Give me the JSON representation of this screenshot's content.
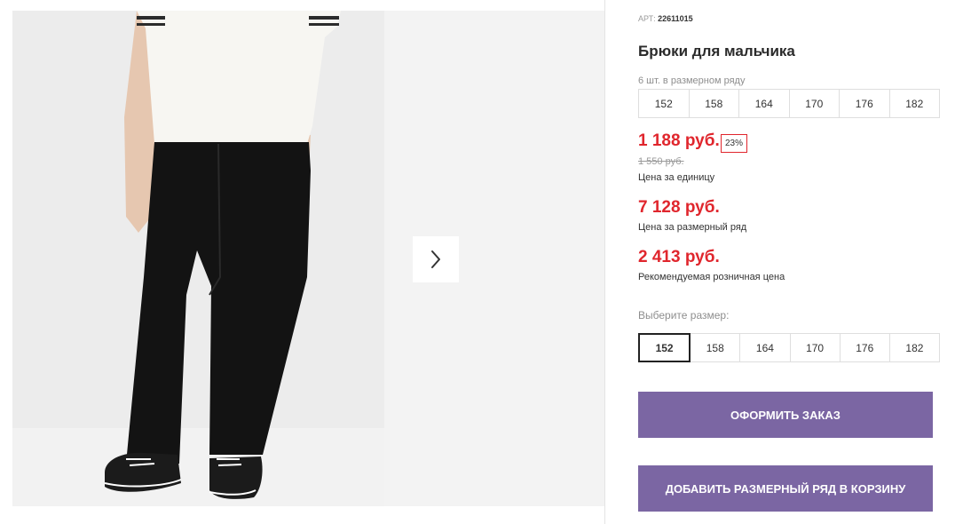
{
  "gallery": {
    "next_icon": "chevron-right-icon",
    "photo_alt": "Брюки для мальчика"
  },
  "product": {
    "article_label": "АРТ:",
    "article_value": "22611015",
    "title": "Брюки для мальчика",
    "pack_note": "6 шт. в размерном ряду",
    "pack_sizes": [
      "152",
      "158",
      "164",
      "170",
      "176",
      "182"
    ]
  },
  "pricing": {
    "unit_price": "1 188 руб.",
    "discount_badge": "23%",
    "old_price": "1 550 руб.",
    "unit_price_label": "Цена за единицу",
    "pack_price": "7 128 руб.",
    "pack_price_label": "Цена за размерный ряд",
    "retail_price": "2 413 руб.",
    "retail_price_label": "Рекомендуемая розничная цена"
  },
  "size_picker": {
    "label": "Выберите размер:",
    "sizes": [
      "152",
      "158",
      "164",
      "170",
      "176",
      "182"
    ],
    "selected": "152"
  },
  "actions": {
    "order_label": "ОФОРМИТЬ ЗАКАЗ",
    "add_pack_label": "ДОБАВИТЬ РАЗМЕРНЫЙ РЯД В КОРЗИНУ"
  },
  "colors": {
    "accent_button": "#7b66a3",
    "price_red": "#e0262d"
  }
}
